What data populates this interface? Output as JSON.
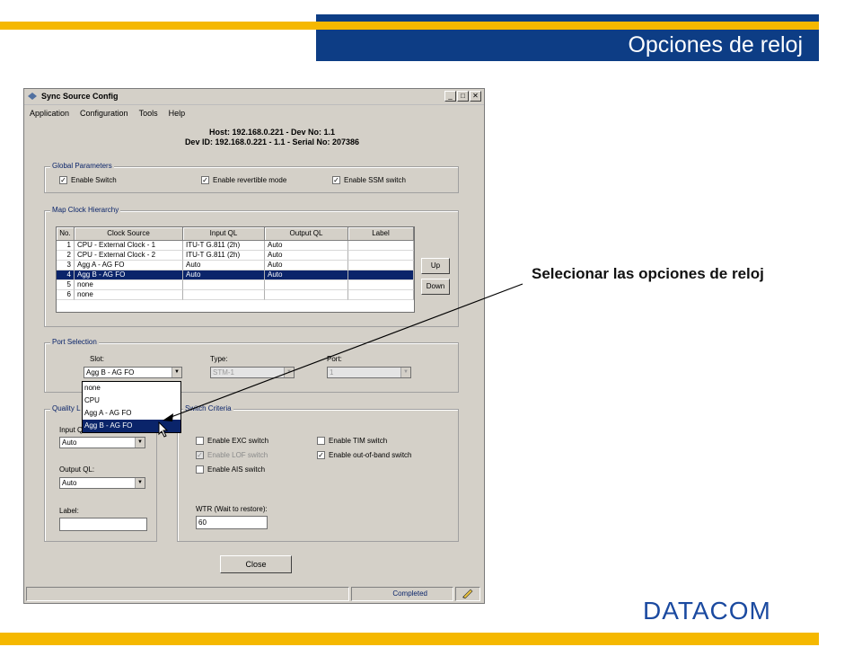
{
  "slide": {
    "title": "Opciones de reloj",
    "callout": "Selecionar las opciones de reloj",
    "brand": "DATACOM"
  },
  "window": {
    "title": "Sync Source Config",
    "controls": [
      "_",
      "□",
      "✕"
    ],
    "menu": [
      "Application",
      "Configuration",
      "Tools",
      "Help"
    ],
    "host_line": "Host: 192.168.0.221 - Dev No: 1.1",
    "dev_line": "Dev ID: 192.168.0.221 - 1.1 - Serial No: 207386",
    "global": {
      "legend": "Global Parameters",
      "enable_switch": "Enable Switch",
      "enable_revertible": "Enable revertible mode",
      "enable_ssm": "Enable SSM switch"
    },
    "hierarchy": {
      "legend": "Map Clock Hierarchy",
      "columns": [
        "No.",
        "Clock Source",
        "Input QL",
        "Output QL",
        "Label"
      ],
      "rows": [
        [
          "1",
          "CPU - External Clock - 1",
          "ITU-T G.811 (2h)",
          "Auto",
          ""
        ],
        [
          "2",
          "CPU - External Clock - 2",
          "ITU-T G.811 (2h)",
          "Auto",
          ""
        ],
        [
          "3",
          "Agg A - AG FO",
          "Auto",
          "Auto",
          ""
        ],
        [
          "4",
          "Agg B - AG FO",
          "Auto",
          "Auto",
          ""
        ],
        [
          "5",
          "none",
          "",
          "",
          ""
        ],
        [
          "6",
          "none",
          "",
          "",
          ""
        ]
      ],
      "selected_row": 4,
      "up": "Up",
      "down": "Down"
    },
    "port": {
      "legend": "Port Selection",
      "slot_label": "Slot:",
      "slot_value": "Agg B - AG FO",
      "type_label": "Type:",
      "type_value": "STM-1",
      "port_label": "Port:",
      "port_value": "1",
      "slot_options": [
        "none",
        "CPU",
        "Agg A - AG FO",
        "Agg B - AG FO"
      ]
    },
    "quality": {
      "legend": "Quality L",
      "input_label": "Input Q",
      "input_value": "Auto",
      "output_label": "Output QL:",
      "output_value": "Auto",
      "label_label": "Label:",
      "label_value": ""
    },
    "switch": {
      "legend": "Switch Criteria",
      "exc": "Enable EXC switch",
      "lof": "Enable LOF switch",
      "ais": "Enable AIS switch",
      "tim": "Enable TIM switch",
      "oob": "Enable out-of-band switch",
      "wtr_label": "WTR (Wait to restore):",
      "wtr_value": "60"
    },
    "close": "Close",
    "status": "Completed"
  }
}
